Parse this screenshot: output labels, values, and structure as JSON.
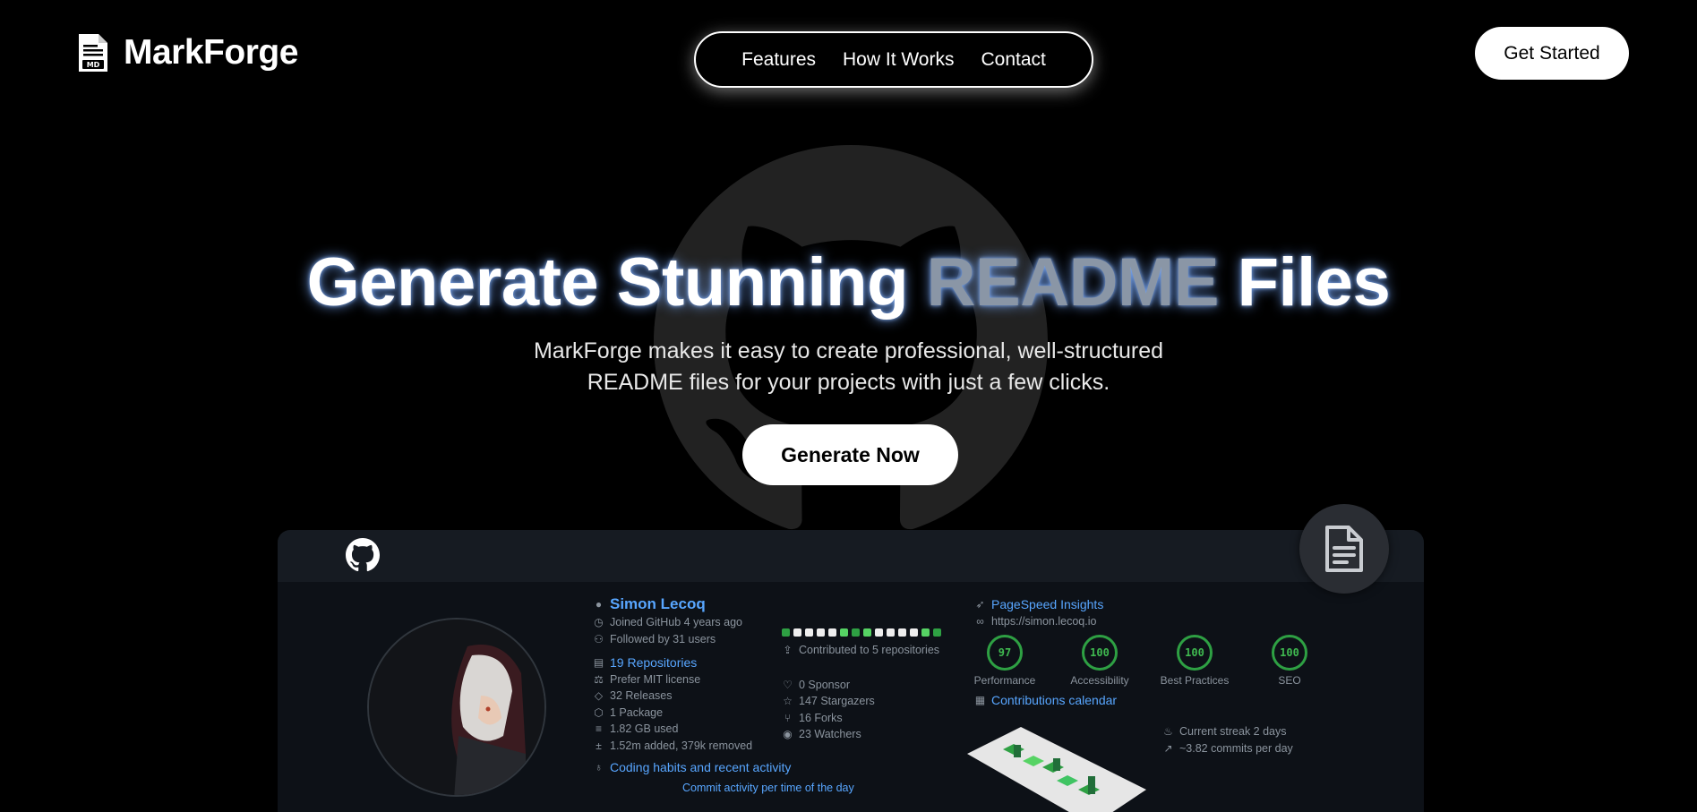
{
  "brand": {
    "name": "MarkForge",
    "logo_icon": "markdown-file-icon",
    "logo_badge": "MD"
  },
  "nav": {
    "items": [
      "Features",
      "How It Works",
      "Contact"
    ]
  },
  "header": {
    "cta_label": "Get Started"
  },
  "hero": {
    "title_part1": "Generate Stunning ",
    "title_accent": "README",
    "title_part2": " Files",
    "subtitle_line1": "MarkForge makes it easy to create professional, well-structured",
    "subtitle_line2": "README files for your projects with just a few clicks.",
    "button_label": "Generate Now",
    "background_icon": "github-octocat-icon"
  },
  "preview": {
    "profile": {
      "name": "Simon Lecoq",
      "joined": "Joined GitHub 4 years ago",
      "followers": "Followed by 31 users",
      "repositories": "19 Repositories",
      "license": "Prefer MIT license",
      "releases": "32 Releases",
      "packages": "1 Package",
      "storage": "1.82 GB used",
      "changes": "1.52m added, 379k removed",
      "habits": "Coding habits and recent activity",
      "commit_activity": "Commit activity per time of the day"
    },
    "activity": {
      "contributed": "Contributed to 5 repositories",
      "sponsors": "0 Sponsor",
      "stargazers": "147 Stargazers",
      "forks": "16 Forks",
      "watchers": "23 Watchers"
    },
    "pagespeed": {
      "title": "PageSpeed Insights",
      "url": "https://simon.lecoq.io",
      "scores": [
        {
          "value": "97",
          "label": "Performance"
        },
        {
          "value": "100",
          "label": "Accessibility"
        },
        {
          "value": "100",
          "label": "Best Practices"
        },
        {
          "value": "100",
          "label": "SEO"
        }
      ]
    },
    "calendar": {
      "title": "Contributions calendar",
      "streak": "Current streak 2 days",
      "commits_per_day": "~3.82 commits per day"
    }
  },
  "colors": {
    "accent_green": "#2ea043",
    "link_blue": "#58a6ff",
    "card_bg": "#0d1117"
  }
}
